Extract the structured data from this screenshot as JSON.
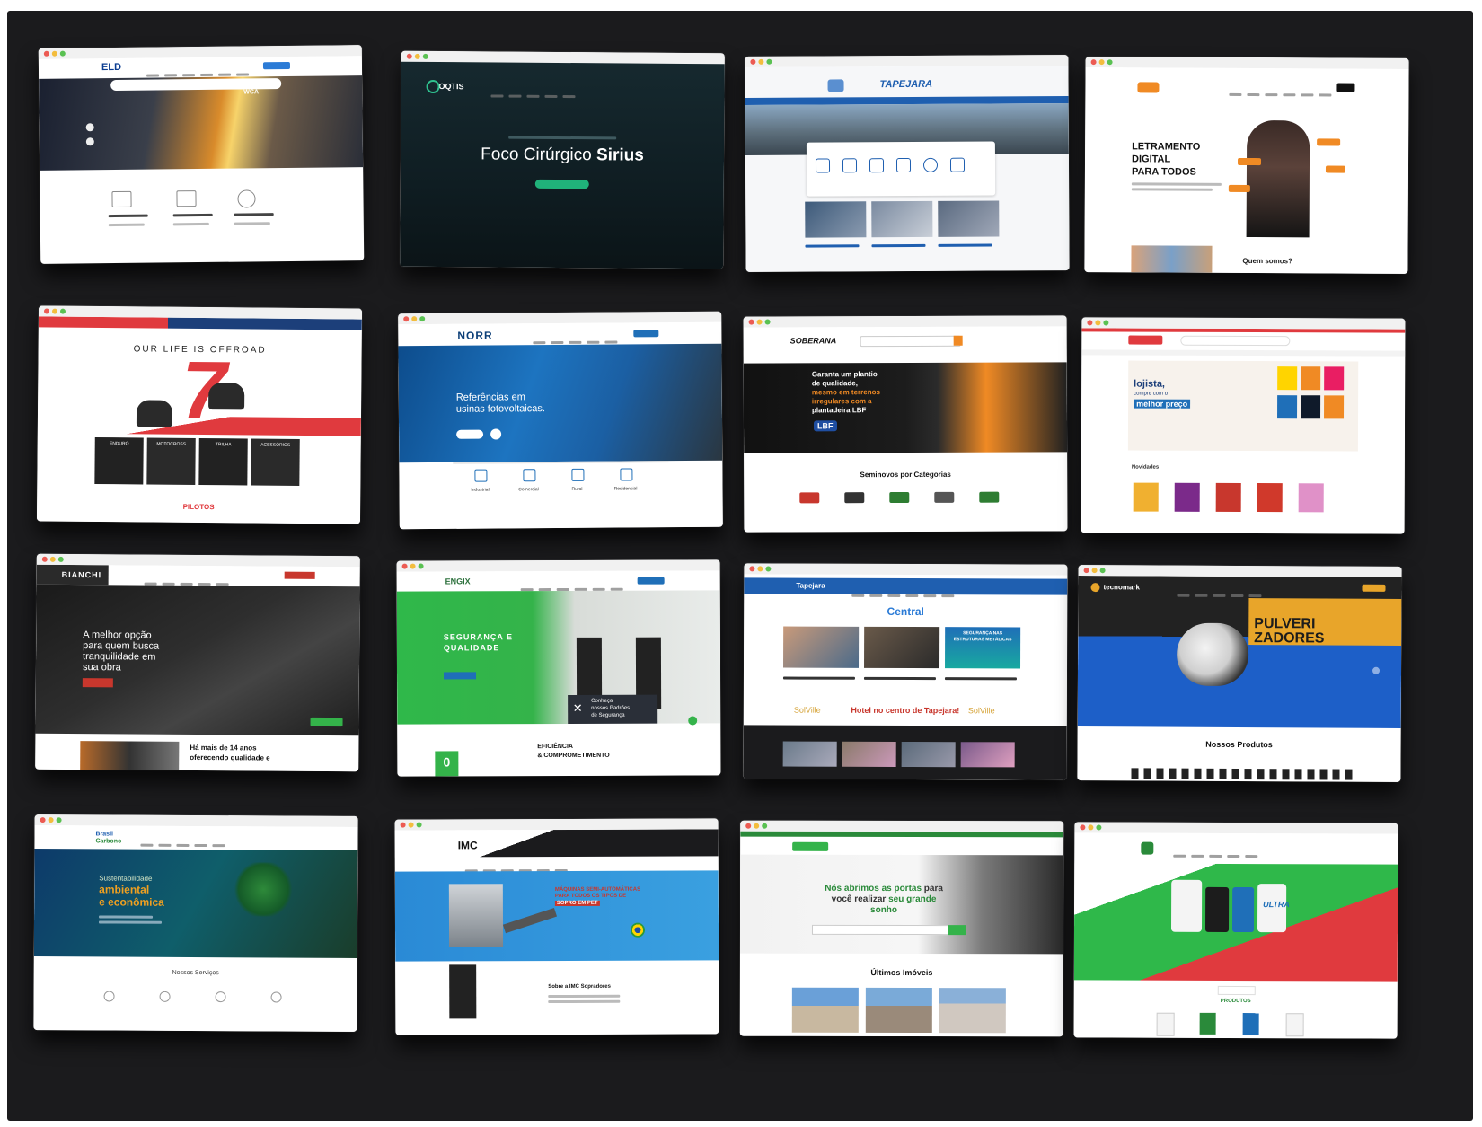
{
  "screenshots": [
    {
      "name": "eld",
      "logo": "ELD",
      "hero_badge": "WCA"
    },
    {
      "name": "oqtis",
      "logo": "OQTIS",
      "hero_light": "Foco Cirúrgico",
      "hero_bold": "Sirius"
    },
    {
      "name": "tapejara",
      "logo": "TAPEJARA"
    },
    {
      "name": "letramento",
      "line1": "LETRAMENTO",
      "line2": "DIGITAL",
      "line3": "PARA TODOS",
      "footer": "Quem somos?"
    },
    {
      "name": "offroad",
      "headline": "OUR LIFE IS OFFROAD",
      "tiles": [
        "ENDURO",
        "MOTOCROSS",
        "TRILHA",
        "ACESSÓRIOS"
      ],
      "footer": "PILOTOS"
    },
    {
      "name": "norr",
      "logo": "NORR",
      "headline1": "Referências em",
      "headline2": "usinas fotovoltaicas.",
      "categories": [
        "Industrial",
        "Comercial",
        "Rural",
        "Residencial"
      ]
    },
    {
      "name": "soberana",
      "logo": "SOBERANA",
      "line1": "Garanta um plantio",
      "line2": "de qualidade,",
      "line3": "mesmo em terrenos",
      "line4": "irregulares com a",
      "line5": "plantadeira LBF",
      "badge": "LBF",
      "section": "Seminovos por Categorias"
    },
    {
      "name": "shop",
      "line1": "lojista,",
      "line2": "compre com o",
      "line3": "melhor preço",
      "section": "Novidades"
    },
    {
      "name": "bianchi",
      "logo": "BIANCHI",
      "line1": "A melhor opção",
      "line2": "para quem busca",
      "line3": "tranquilidade em",
      "line4": "sua obra",
      "footer1": "Há mais de 14 anos",
      "footer2": "oferecendo qualidade e"
    },
    {
      "name": "engix",
      "logo": "ENGIX",
      "line1": "SEGURANÇA E",
      "line2": "QUALIDADE",
      "overlay1": "Conheça",
      "overlay2": "nossos Padrões",
      "overlay3": "de Segurança",
      "footer1": "EFICIÊNCIA",
      "footer2": "& COMPROMETIMENTO",
      "counter": "0"
    },
    {
      "name": "central",
      "logo": "Tapejara",
      "brand": "Central",
      "banner1": "SEGURANÇA NAS",
      "banner2": "ESTRUTURAS METÁLICAS",
      "ad_left": "SolVille",
      "ad_mid": "Hotel no centro de Tapejara!",
      "ad_right": "SolVille"
    },
    {
      "name": "tecnomark",
      "logo": "tecnomark",
      "line1": "PULVERI",
      "line2": "ZADORES",
      "section": "Nossos Produtos"
    },
    {
      "name": "brasil-carbono",
      "logo1": "Brasil",
      "logo2": "Carbono",
      "line1": "Sustentabilidade",
      "line2": "ambiental",
      "line3": "e econômica",
      "section": "Nossos Serviços"
    },
    {
      "name": "imc",
      "logo": "IMC",
      "line1": "MÁQUINAS SEMI-AUTOMÁTICAS",
      "line2": "PARA TODOS OS TIPOS DE",
      "line3": "SOPRO EM PET",
      "footer": "Sobre a IMC Sopradores"
    },
    {
      "name": "imoveis",
      "line1a": "Nós abrimos as portas",
      "line1b": "para",
      "line2a": "você realizar",
      "line2b": "seu grande",
      "line3": "sonho",
      "section": "Últimos Imóveis"
    },
    {
      "name": "ultra",
      "brand": "ULTRA",
      "section": "PRODUTOS"
    }
  ],
  "colors": {
    "board": "#1b1b1d",
    "orange": "#f08a24",
    "blue": "#1f6fb8",
    "green": "#34b34a",
    "red": "#e03a3e"
  }
}
